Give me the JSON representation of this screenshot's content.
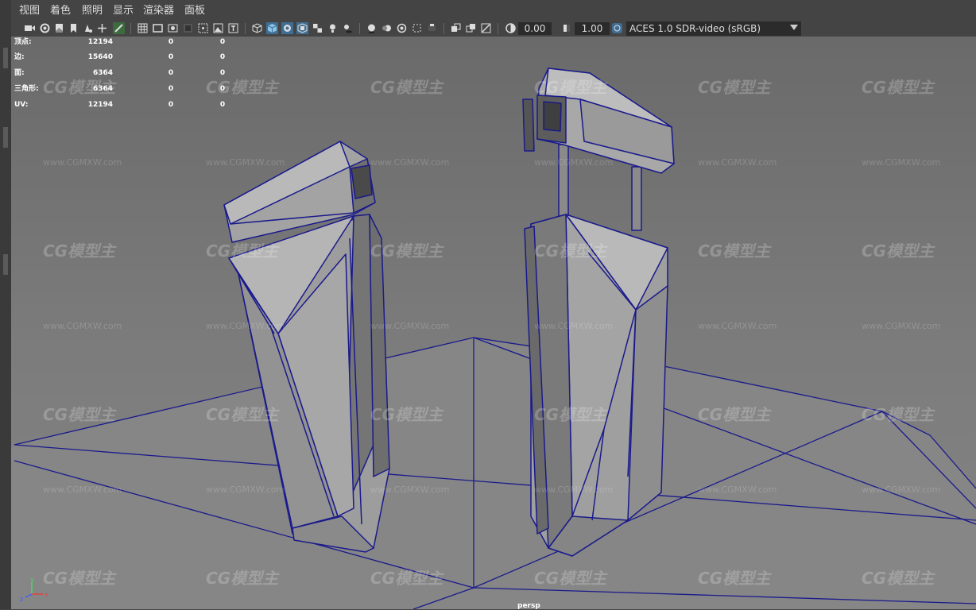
{
  "menu": {
    "items": [
      "视图",
      "着色",
      "照明",
      "显示",
      "渲染器",
      "面板"
    ]
  },
  "toolbar": {
    "exposure_value": "0.00",
    "gamma_value": "1.00",
    "color_space": "ACES 1.0 SDR-video (sRGB)",
    "icons": [
      "camera-icon",
      "camera-attributes-icon",
      "bookmark-icon",
      "image-plane-icon",
      "2d-pan-icon",
      "grease-pencil-icon",
      "grid-icon",
      "film-gate-icon",
      "resolution-gate-icon",
      "gate-mask-icon",
      "field-chart-icon",
      "safe-action-icon",
      "safe-title-icon",
      "wireframe-icon",
      "smooth-shade-icon",
      "default-material-icon",
      "textured-icon",
      "use-all-lights-icon",
      "shadows-icon",
      "screen-space-ao-icon",
      "motion-blur-icon",
      "multisample-aa-icon",
      "depth-of-field-icon",
      "isolate-select-icon",
      "xray-icon",
      "xray-active-components-icon",
      "xray-joints-icon",
      "exposure-icon",
      "gamma-icon",
      "color-management-icon"
    ]
  },
  "hud": {
    "rows": [
      {
        "label": "顶点:",
        "v1": "12194",
        "v2": "0",
        "v3": "0"
      },
      {
        "label": "边:",
        "v1": "15640",
        "v2": "0",
        "v3": "0"
      },
      {
        "label": "面:",
        "v1": "6364",
        "v2": "0",
        "v3": "0"
      },
      {
        "label": "三角形:",
        "v1": "6364",
        "v2": "0",
        "v3": "0"
      },
      {
        "label": "UV:",
        "v1": "12194",
        "v2": "0",
        "v3": "0"
      }
    ]
  },
  "viewport": {
    "camera": "persp",
    "axis_labels": {
      "x": "x",
      "y": "y",
      "z": "z"
    }
  },
  "watermark": {
    "logo_text": "CG模型主",
    "url": "www.CGMXW.com"
  },
  "colors": {
    "ui_bg": "#444444",
    "viewport_bg": "#7a7a7a",
    "wire": "#1a1a8c",
    "active_icon": "#5aa0d8"
  }
}
